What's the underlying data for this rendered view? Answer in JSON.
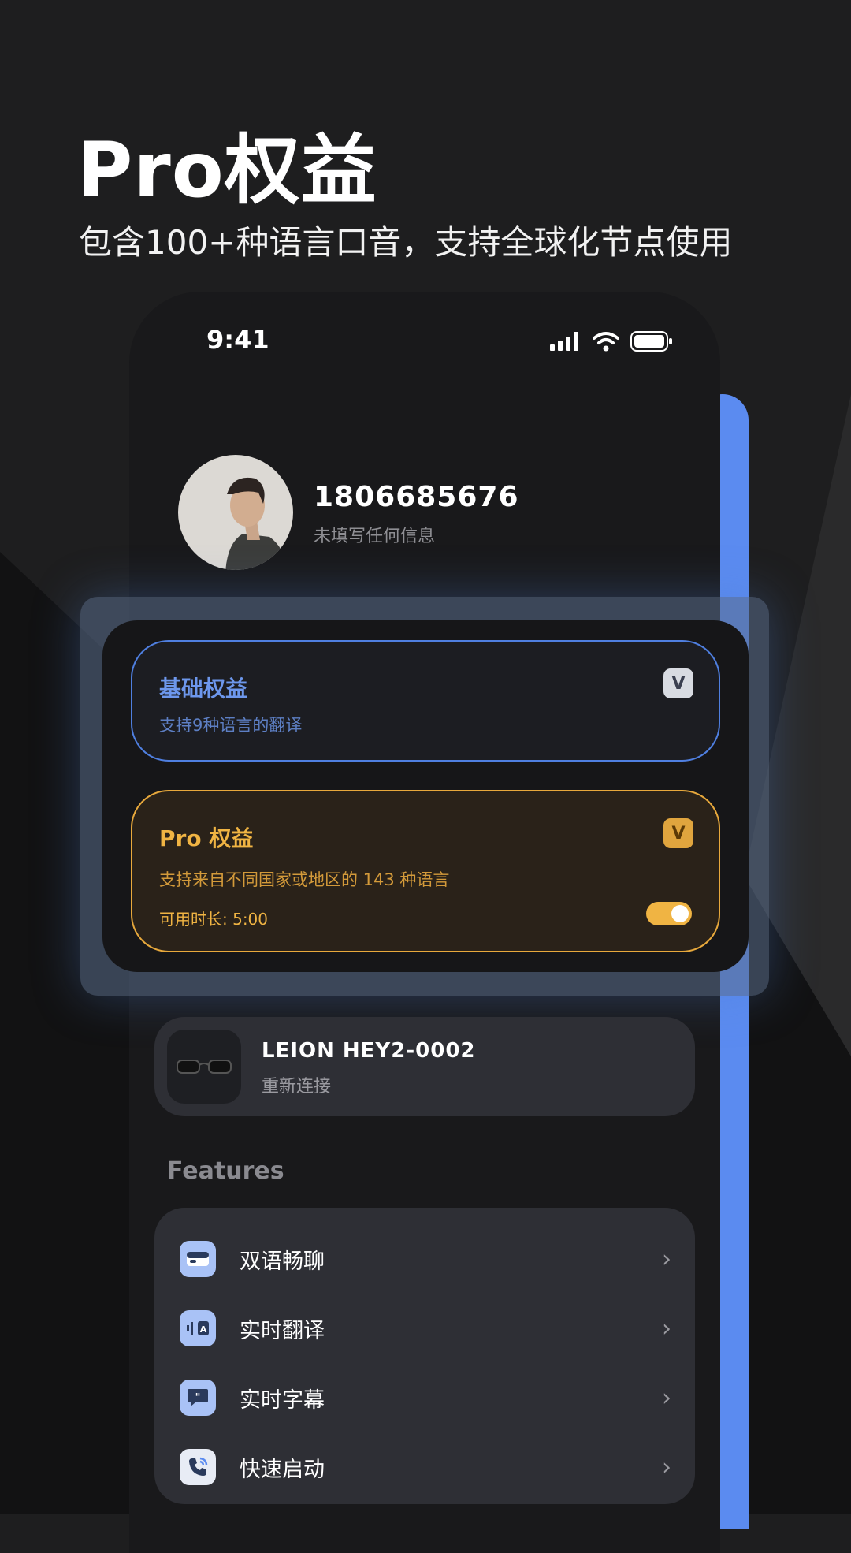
{
  "headline": "Pro权益",
  "subheadline": "包含100+种语言口音，支持全球化节点使用",
  "status_bar": {
    "time": "9:41"
  },
  "profile": {
    "phone": "1806685676",
    "note": "未填写任何信息"
  },
  "basic_card": {
    "title": "基础权益",
    "desc": "支持9种语言的翻译",
    "badge": "V",
    "color": "#5b8bf0"
  },
  "pro_card": {
    "title": "Pro 权益",
    "desc": "支持来自不同国家或地区的 143 种语言",
    "duration": "可用时长: 5:00",
    "badge": "V",
    "toggle_on": true,
    "color": "#e8a93c"
  },
  "device": {
    "name": "LEION HEY2-0002",
    "status": "重新连接"
  },
  "features": {
    "label": "Features",
    "items": [
      {
        "label": "双语畅聊",
        "icon": "chat-window-icon"
      },
      {
        "label": "实时翻译",
        "icon": "voice-translate-icon"
      },
      {
        "label": "实时字幕",
        "icon": "quote-bubble-icon"
      },
      {
        "label": "快速启动",
        "icon": "phone-call-icon"
      }
    ]
  }
}
